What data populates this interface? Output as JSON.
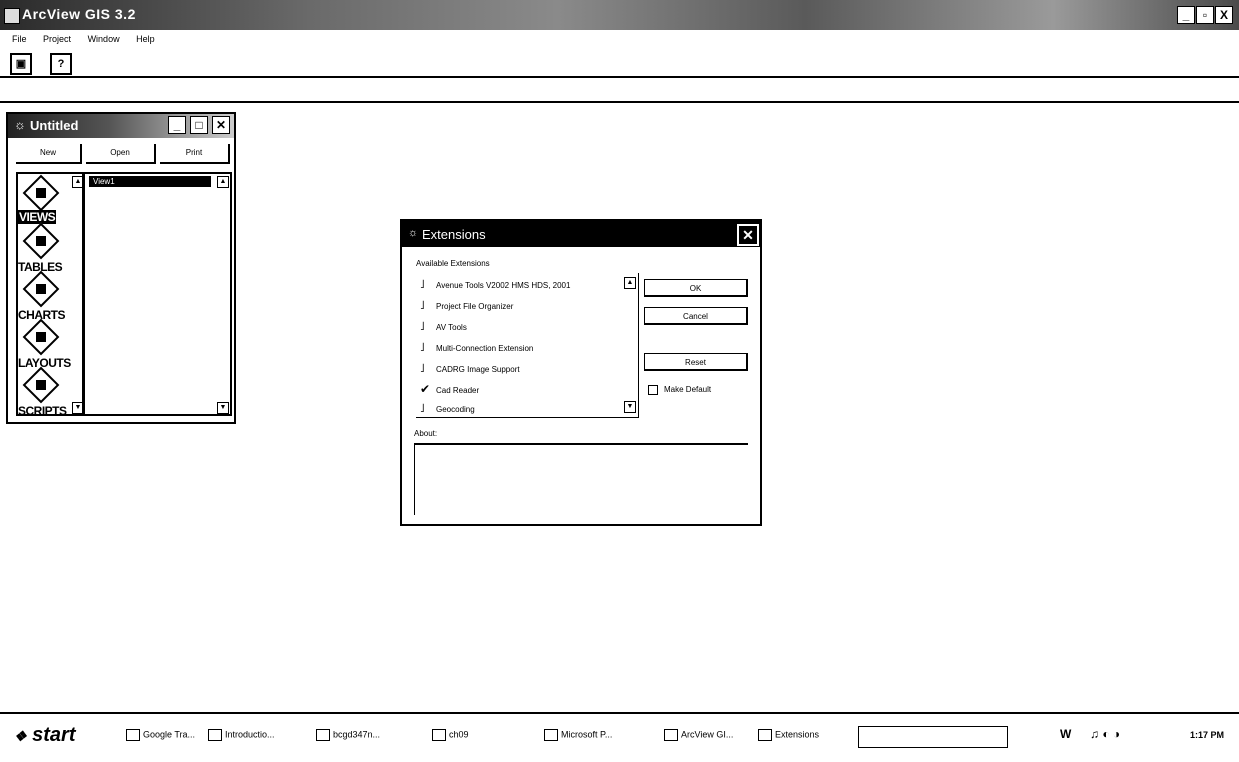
{
  "app": {
    "title": "ArcView GIS 3.2",
    "window_buttons": [
      "_",
      "▫",
      "X"
    ]
  },
  "menu": [
    "File",
    "Project",
    "Window",
    "Help"
  ],
  "toolbar": {
    "save_icon": "save-icon",
    "help_icon": "help-icon"
  },
  "project": {
    "title": "Untitled",
    "buttons": [
      "New",
      "Open",
      "Print"
    ],
    "doc_types": [
      {
        "label": "VIEWS",
        "selected": true
      },
      {
        "label": "TABLES",
        "selected": false
      },
      {
        "label": "CHARTS",
        "selected": false
      },
      {
        "label": "LAYOUTS",
        "selected": false
      },
      {
        "label": "SCRIPTS",
        "selected": false
      }
    ],
    "selected_item": "View1"
  },
  "extensions_dialog": {
    "title": "Extensions",
    "available_label": "Available Extensions",
    "extensions": [
      {
        "name": "Avenue Tools V2002 HMS HDS, 2001",
        "checked": false
      },
      {
        "name": "Project File Organizer",
        "checked": false
      },
      {
        "name": "AV Tools",
        "checked": false
      },
      {
        "name": "Multi-Connection Extension",
        "checked": false
      },
      {
        "name": "CADRG Image Support",
        "checked": false
      },
      {
        "name": "Cad Reader",
        "checked": true
      },
      {
        "name": "Geocoding",
        "checked": false
      }
    ],
    "ok_label": "OK",
    "cancel_label": "Cancel",
    "reset_label": "Reset",
    "make_default_label": "Make Default",
    "about_label": "About:"
  },
  "taskbar": {
    "start_label": "start",
    "tasks": [
      "Google Tra...",
      "Introductio...",
      "bcgd347n...",
      "ch09",
      "Microsoft P...",
      "ArcView GI...",
      "Extensions"
    ],
    "clock": "1:17 PM"
  }
}
